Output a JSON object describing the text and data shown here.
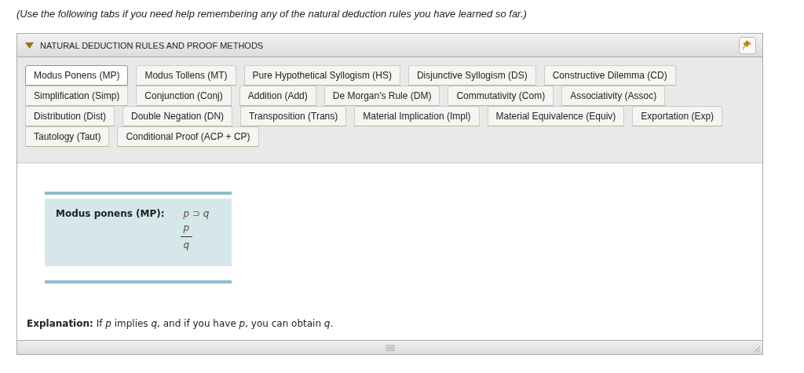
{
  "intro": "(Use the following tabs if you need help remembering any of the natural deduction rules you have learned so far.)",
  "panel": {
    "title": "NATURAL DEDUCTION RULES AND PROOF METHODS",
    "expanded": true,
    "tab_rows": [
      {
        "tabs": [
          {
            "label": "Modus Ponens (MP)",
            "selected": true
          },
          {
            "label": "Modus Tollens (MT)",
            "selected": false
          },
          {
            "label": "Pure Hypothetical Syllogism (HS)",
            "selected": false
          },
          {
            "label": "Disjunctive Syllogism (DS)",
            "selected": false
          },
          {
            "label": "Constructive Dilemma (CD)",
            "selected": false
          }
        ]
      },
      {
        "tabs": [
          {
            "label": "Simplification (Simp)",
            "selected": false
          },
          {
            "label": "Conjunction (Conj)",
            "selected": false
          },
          {
            "label": "Addition (Add)",
            "selected": false
          },
          {
            "label": "De Morgan's Rule (DM)",
            "selected": false
          },
          {
            "label": "Commutativity (Com)",
            "selected": false
          },
          {
            "label": "Associativity (Assoc)",
            "selected": false
          }
        ]
      },
      {
        "tabs": [
          {
            "label": "Distribution (Dist)",
            "selected": false
          },
          {
            "label": "Double Negation (DN)",
            "selected": false
          },
          {
            "label": "Transposition (Trans)",
            "selected": false
          },
          {
            "label": "Material Implication (Impl)",
            "selected": false
          },
          {
            "label": "Material Equivalence (Equiv)",
            "selected": false
          },
          {
            "label": "Exportation (Exp)",
            "selected": false
          }
        ]
      },
      {
        "tabs": [
          {
            "label": "Tautology (Taut)",
            "selected": false
          },
          {
            "label": "Conditional Proof (ACP + CP)",
            "selected": false
          }
        ]
      }
    ],
    "rule": {
      "name": "Modus ponens (MP):",
      "premises": [
        "p ⊃ q",
        "p"
      ],
      "conclusion": "q"
    },
    "explanation": "**Explanation:** If *p* implies *q*, and if you have *p*, you can obtain *q*."
  }
}
